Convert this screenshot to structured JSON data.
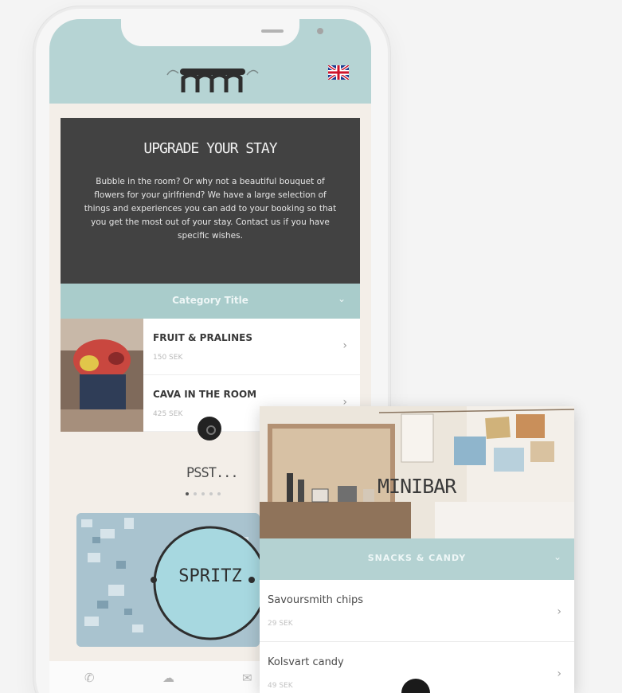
{
  "app": {
    "upgrade_title": "UPGRADE YOUR STAY",
    "upgrade_text": "Bubble in the room? Or why not a beautiful bouquet of flowers for your girlfriend? We have a large selection of things and experiences you can add to your booking so that you get the most out of your stay. Contact us if you have specific wishes.",
    "category_title": "Category Title",
    "items": [
      {
        "name": "FRUIT & PRALINES",
        "price": "150 SEK"
      },
      {
        "name": "CAVA IN THE ROOM",
        "price": "425 SEK"
      }
    ],
    "psst": "PSST...",
    "banner_text": "SPRITZ"
  },
  "minibar_card": {
    "hero_title": "MINIBAR",
    "section_title": "SNACKS & CANDY",
    "items": [
      {
        "name": "Savoursmith chips",
        "price": "29 SEK"
      },
      {
        "name": "Kolsvart candy",
        "price": "49 SEK"
      }
    ]
  },
  "colors": {
    "accent": "#b6d4d4",
    "dark_panel": "#424242",
    "background": "#f3eee8"
  }
}
